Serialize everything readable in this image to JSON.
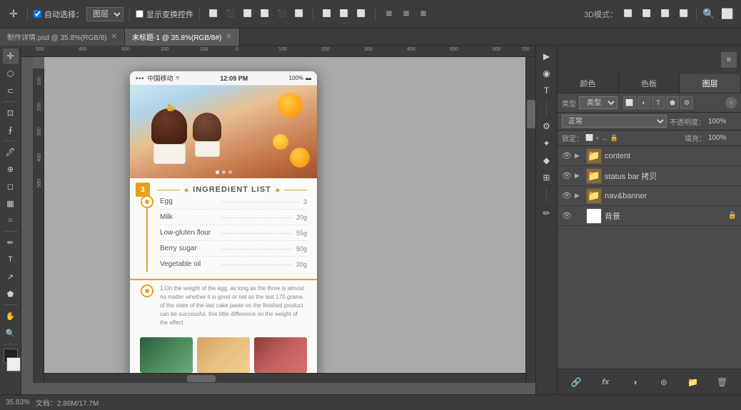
{
  "toolbar": {
    "auto_select_label": "自动选择：",
    "layer_label": "图层",
    "show_transform_label": "显示变换控件",
    "mode_3d": "3D模式：",
    "zoom_icon": "🔍",
    "close_icon": "⊞"
  },
  "tabs": [
    {
      "label": "制作详情.psd @ 35.8%(RGB/8)",
      "active": false
    },
    {
      "label": "未标题-1 @ 35.8%(RGB/8#)",
      "active": true
    }
  ],
  "right_panel": {
    "tabs": [
      {
        "label": "颜色",
        "active": false
      },
      {
        "label": "色板",
        "active": false
      },
      {
        "label": "图层",
        "active": true
      }
    ],
    "search_placeholder": "类型",
    "blend_mode": "正常",
    "opacity_label": "不透明度：",
    "opacity_value": "100%",
    "lock_label": "锁定：",
    "fill_label": "填充：",
    "fill_value": "100%",
    "layers": [
      {
        "name": "content",
        "type": "folder",
        "visible": true,
        "expanded": true
      },
      {
        "name": "status bar 拷贝",
        "type": "folder",
        "visible": true,
        "expanded": false
      },
      {
        "name": "nav&banner",
        "type": "folder",
        "visible": true,
        "expanded": false
      },
      {
        "name": "背景",
        "type": "image",
        "visible": true,
        "locked": true,
        "selected": false
      }
    ]
  },
  "phone": {
    "status_bar": {
      "carrier": "中国移动",
      "time": "12:09 PM",
      "battery": "100%"
    },
    "section_num": "3",
    "section_title": "INGREDIENT LIST",
    "title_diamond_left": "◆",
    "title_diamond_right": "◆",
    "ingredients": [
      {
        "name": "Egg",
        "amount": "3"
      },
      {
        "name": "Milk",
        "amount": "20g"
      },
      {
        "name": "Low-gluten flour",
        "amount": "55g"
      },
      {
        "name": "Berry sugar",
        "amount": "50g"
      },
      {
        "name": "Vegetable oil",
        "amount": "20g"
      }
    ],
    "instruction_text": "1.On the weight of the egg, as long as the three is almost no matter whether it is good or not as the last 170 grams of the state of the last cake paste on the finished product can be successful, this little difference on the weight of the effect"
  },
  "status_bar": {
    "zoom": "35.83%",
    "doc_size": "文档：2.86M/17.7M"
  },
  "tools": {
    "left": [
      "✛",
      "⬡",
      "🔲",
      "✏",
      "⬜",
      "∅",
      "✂",
      "🖊",
      "🖋",
      "T",
      "↗",
      "🔍",
      "🖐"
    ],
    "right_vert": [
      "▶",
      "🔲",
      "⚙",
      "✦",
      "🔶",
      "⚙",
      "🖊"
    ]
  }
}
